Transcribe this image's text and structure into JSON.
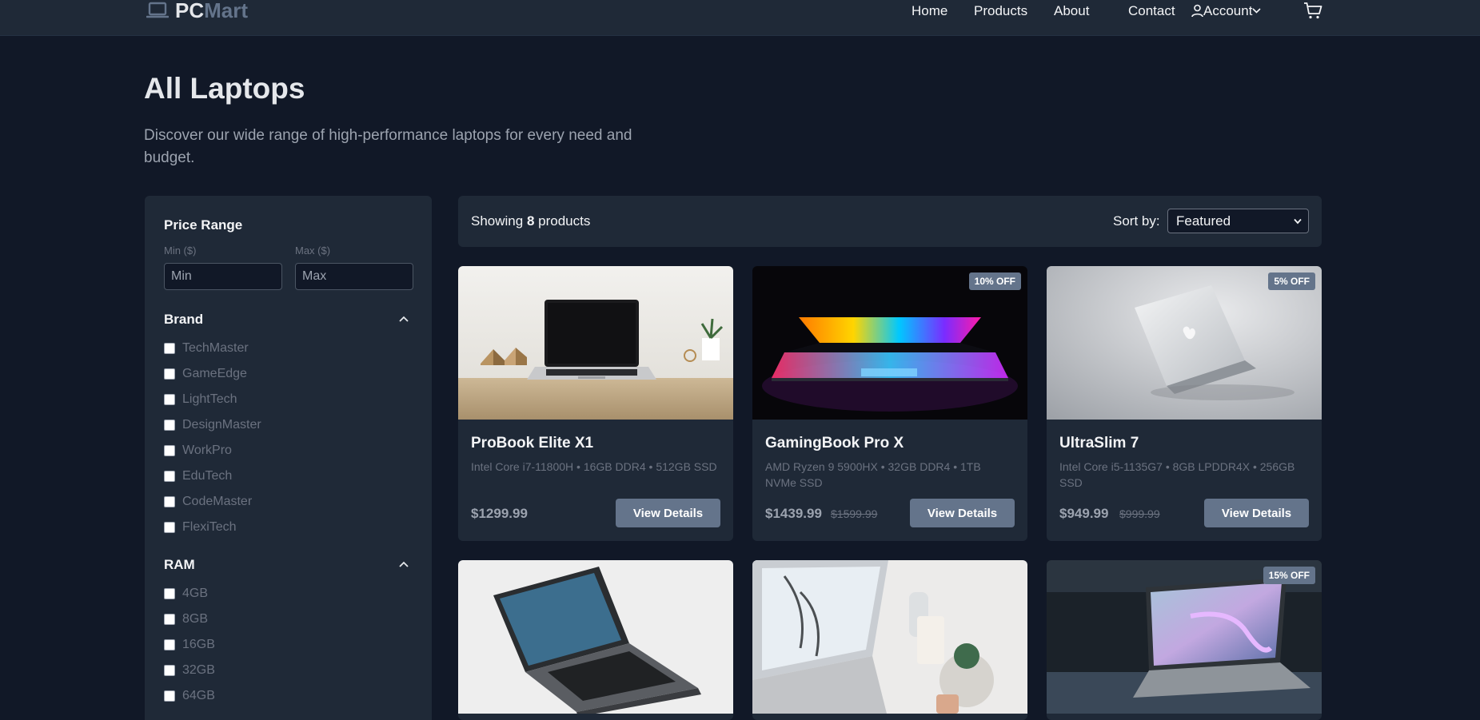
{
  "header": {
    "logo": {
      "brand_part1": "PC",
      "brand_part2": "Mart",
      "icon": "laptop-icon"
    },
    "nav": [
      {
        "label": "Home"
      },
      {
        "label": "Products"
      },
      {
        "label": "About"
      },
      {
        "label": "Contact"
      }
    ],
    "account": {
      "label": "Account",
      "icon": "user-icon",
      "dropdown_icon": "chevron-down-icon"
    },
    "cart_icon": "cart-icon"
  },
  "page": {
    "title": "All Laptops",
    "subtitle": "Discover our wide range of high-performance laptops for every need and budget."
  },
  "filters": {
    "price": {
      "title": "Price Range",
      "min_label": "Min ($)",
      "max_label": "Max ($)",
      "min_placeholder": "Min",
      "max_placeholder": "Max"
    },
    "brand": {
      "title": "Brand",
      "options": [
        "TechMaster",
        "GameEdge",
        "LightTech",
        "DesignMaster",
        "WorkPro",
        "EduTech",
        "CodeMaster",
        "FlexiTech"
      ]
    },
    "ram": {
      "title": "RAM",
      "options": [
        "4GB",
        "8GB",
        "16GB",
        "32GB",
        "64GB"
      ]
    }
  },
  "toolbar": {
    "showing_prefix": "Showing",
    "count": "8",
    "showing_suffix": "products",
    "sort_label": "Sort by:",
    "sort_value": "Featured"
  },
  "products": [
    {
      "title": "ProBook Elite X1",
      "specs": "Intel Core i7-11800H • 16GB DDR4 • 512GB SSD",
      "price": "$1299.99",
      "old_price": "",
      "badge": "",
      "button": "View Details"
    },
    {
      "title": "GamingBook Pro X",
      "specs": "AMD Ryzen 9 5900HX • 32GB DDR4 • 1TB NVMe SSD",
      "price": "$1439.99",
      "old_price": "$1599.99",
      "badge": "10% OFF",
      "button": "View Details"
    },
    {
      "title": "UltraSlim 7",
      "specs": "Intel Core i5-1135G7 • 8GB LPDDR4X • 256GB SSD",
      "price": "$949.99",
      "old_price": "$999.99",
      "badge": "5% OFF",
      "button": "View Details"
    },
    {
      "badge": ""
    },
    {
      "badge": ""
    },
    {
      "badge": "15% OFF"
    }
  ],
  "colors": {
    "background": "#111827",
    "surface": "#1f2937",
    "accent": "#64748b",
    "text": "#f3f4f6",
    "muted": "#6b7280"
  }
}
